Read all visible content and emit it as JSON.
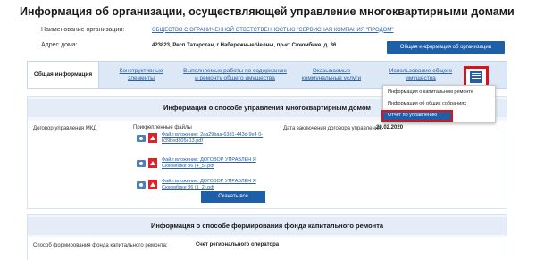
{
  "page_title": "Информация об организации, осуществляющей управление многоквартирными домами",
  "org": {
    "label": "Наименование организации:",
    "name": "ОБЩЕСТВО С ОГРАНИЧЕННОЙ ОТВЕТСТВЕННОСТЬЮ \"СЕРВИСНАЯ КОМПАНИЯ \"ПРОДОМ\"",
    "address_label": "Адрес дома:",
    "address": "423823, Респ Татарстан, г Набережные Челны, пр-кт Сююмбике, д. 36",
    "general_button": "Общая информация об организации"
  },
  "tabs": [
    {
      "label": "Общая информация"
    },
    {
      "label": "Конструктивные элементы"
    },
    {
      "label": "Выполняемые работы по содержанию и ремонту общего имущества"
    },
    {
      "label": "Оказываемые коммунальные услуги"
    },
    {
      "label": "Использование общего имущества"
    }
  ],
  "menu_icon": "hamburger-menu-icon",
  "dropdown": {
    "items": [
      "Информация о капитальном ремонте",
      "Информация об общих собраниях",
      "Отчет по управлению"
    ]
  },
  "management": {
    "header": "Информация о способе управления многоквартирным домом",
    "contract_label": "Договор управления МКД",
    "files_label": "Прикрепленные файлы",
    "files": [
      "Файл вложение: 2aa29baa-63d1-443d-9e4 0-b39bed805e13.pdf",
      "Файл вложение: ДОГОВОР УПРАВЛЕН Я Сююмбике 36 (4_5).pdf",
      "Файл вложение: ДОГОВОР УПРАВЛЕН Я Сююмбике 36 (1_2).pdf"
    ],
    "date_label": "Дата заключения договора управления:",
    "date_value": "20.02.2020",
    "download_button": "Скачать все"
  },
  "capital": {
    "header": "Информация о способе формирования фонда капитального ремонта",
    "method_label": "Способ формирования фонда капитального ремонта:",
    "method_value": "Счет регионального оператора"
  },
  "colors": {
    "accent": "#1f5fa8",
    "highlight": "#d8131c",
    "link": "#2a62a8",
    "tab_bar": "#dce8f5"
  }
}
